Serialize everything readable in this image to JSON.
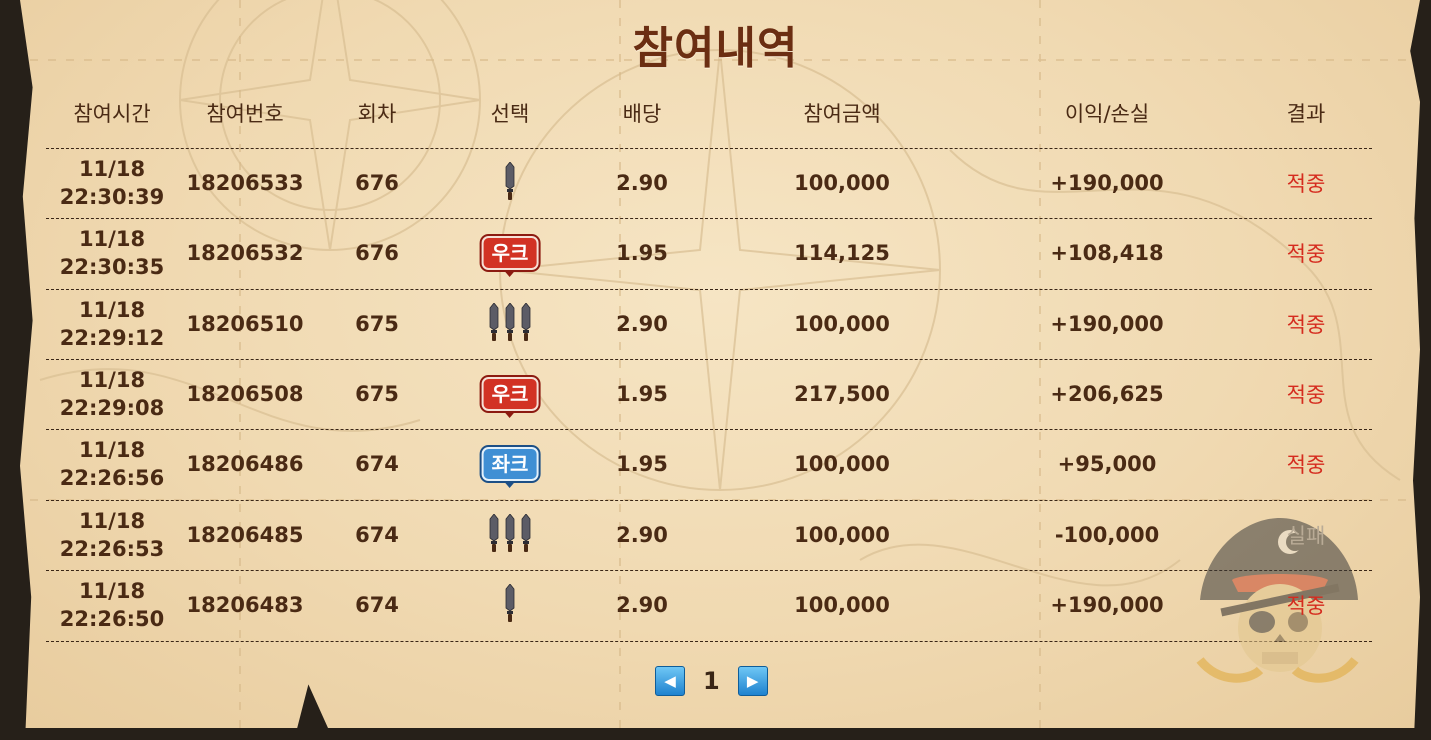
{
  "title": "참여내역",
  "columns": {
    "time": "참여시간",
    "number": "참여번호",
    "round": "회차",
    "choice": "선택",
    "odds": "배당",
    "amount": "참여금액",
    "profit": "이익/손실",
    "result": "결과"
  },
  "rows": [
    {
      "date": "11/18",
      "time": "22:30:39",
      "number": "18206533",
      "round": "676",
      "choice": "knife-1",
      "choice_label": "",
      "odds": "2.90",
      "amount": "100,000",
      "profit": "+190,000",
      "result": "적중",
      "status": "win"
    },
    {
      "date": "11/18",
      "time": "22:30:35",
      "number": "18206532",
      "round": "676",
      "choice": "badge-red",
      "choice_label": "우크",
      "odds": "1.95",
      "amount": "114,125",
      "profit": "+108,418",
      "result": "적중",
      "status": "win"
    },
    {
      "date": "11/18",
      "time": "22:29:12",
      "number": "18206510",
      "round": "675",
      "choice": "knife-3",
      "choice_label": "",
      "odds": "2.90",
      "amount": "100,000",
      "profit": "+190,000",
      "result": "적중",
      "status": "win"
    },
    {
      "date": "11/18",
      "time": "22:29:08",
      "number": "18206508",
      "round": "675",
      "choice": "badge-red",
      "choice_label": "우크",
      "odds": "1.95",
      "amount": "217,500",
      "profit": "+206,625",
      "result": "적중",
      "status": "win"
    },
    {
      "date": "11/18",
      "time": "22:26:56",
      "number": "18206486",
      "round": "674",
      "choice": "badge-blue",
      "choice_label": "좌크",
      "odds": "1.95",
      "amount": "100,000",
      "profit": "+95,000",
      "result": "적중",
      "status": "win"
    },
    {
      "date": "11/18",
      "time": "22:26:53",
      "number": "18206485",
      "round": "674",
      "choice": "knife-3",
      "choice_label": "",
      "odds": "2.90",
      "amount": "100,000",
      "profit": "-100,000",
      "result": "실패",
      "status": "lose"
    },
    {
      "date": "11/18",
      "time": "22:26:50",
      "number": "18206483",
      "round": "674",
      "choice": "knife-1",
      "choice_label": "",
      "odds": "2.90",
      "amount": "100,000",
      "profit": "+190,000",
      "result": "적중",
      "status": "win"
    }
  ],
  "pagination": {
    "prev_icon": "arrow-left-icon",
    "current": "1",
    "next_icon": "arrow-right-icon"
  },
  "colors": {
    "win": "#d52b1e",
    "lose": "#b9ab96",
    "text": "#4a2a14",
    "title": "#6b2e12"
  }
}
